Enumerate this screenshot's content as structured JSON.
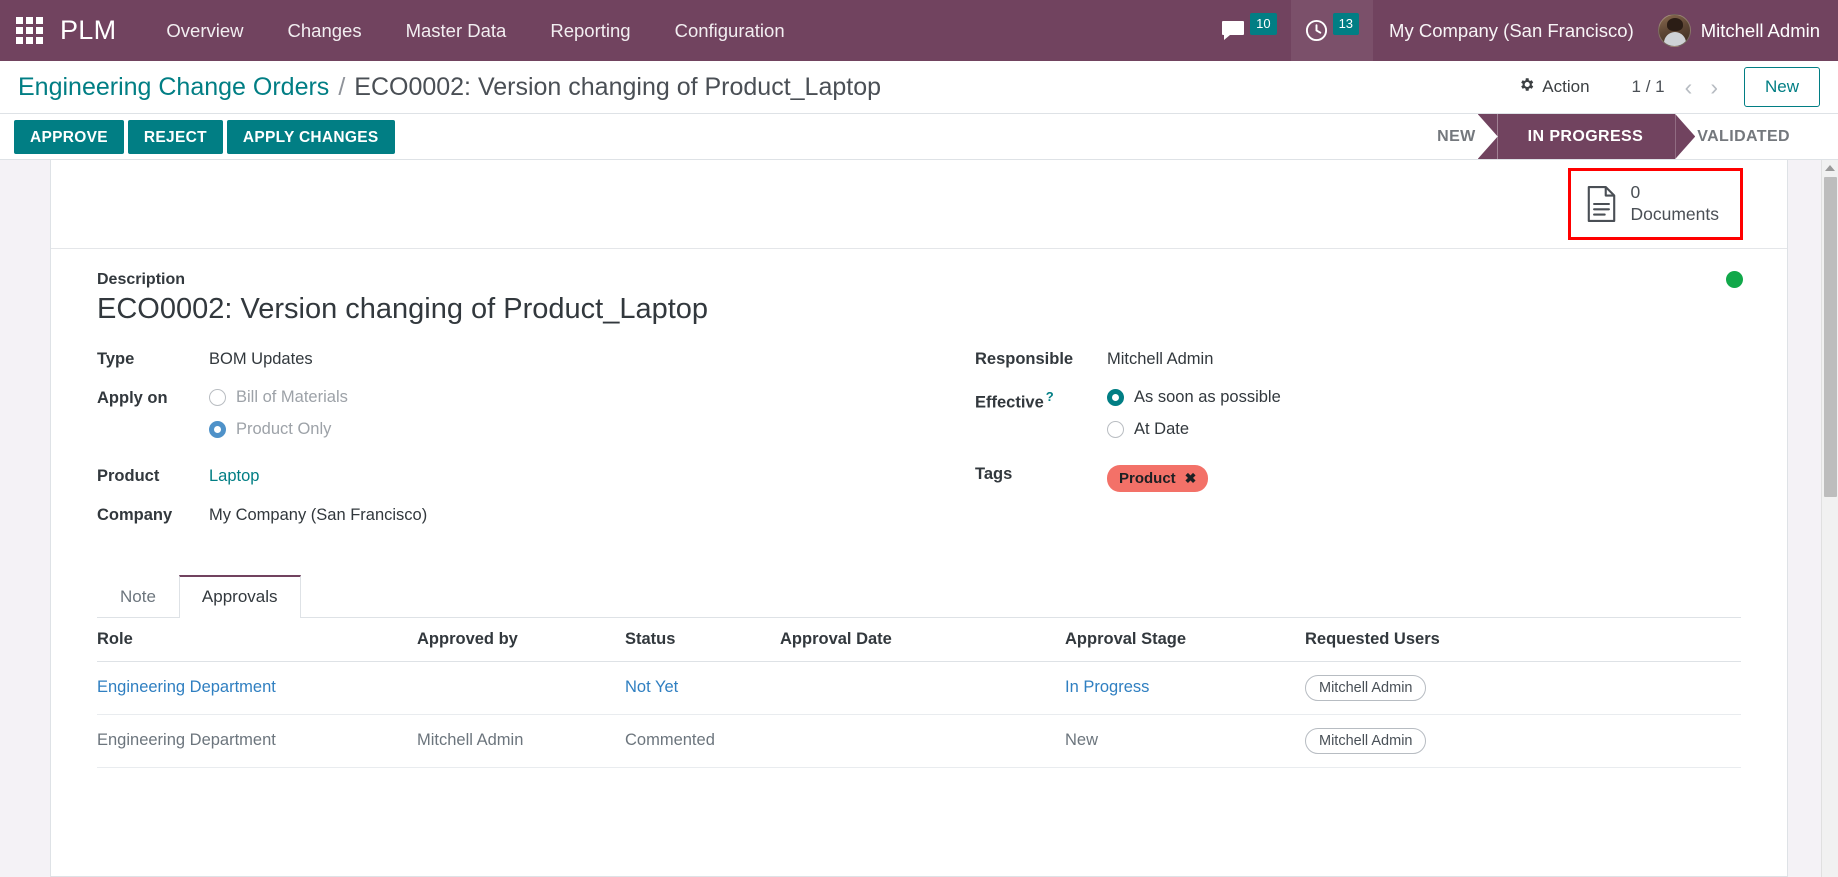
{
  "navbar": {
    "apps_icon": "apps-grid-icon",
    "brand": "PLM",
    "menu": [
      {
        "label": "Overview"
      },
      {
        "label": "Changes"
      },
      {
        "label": "Master Data"
      },
      {
        "label": "Reporting"
      },
      {
        "label": "Configuration"
      }
    ],
    "messages": {
      "icon": "chat-icon",
      "count": "10"
    },
    "activities": {
      "icon": "clock-icon",
      "count": "13"
    },
    "company": "My Company (San Francisco)",
    "user": "Mitchell Admin",
    "avatar_icon": "user-avatar",
    "bg_color": "#71435f"
  },
  "control_panel": {
    "breadcrumb_root": "Engineering Change Orders",
    "breadcrumb_separator": "/",
    "breadcrumb_current": "ECO0002: Version changing of Product_Laptop",
    "action_label": "Action",
    "action_icon": "gear-icon",
    "pager": "1 / 1",
    "prev_icon": "chevron-left-icon",
    "next_icon": "chevron-right-icon",
    "new_label": "New",
    "accent_color": "#017e84"
  },
  "statusbar": {
    "buttons": [
      {
        "label": "APPROVE"
      },
      {
        "label": "REJECT"
      },
      {
        "label": "APPLY CHANGES"
      }
    ],
    "stages": [
      {
        "label": "NEW",
        "active": false
      },
      {
        "label": "IN PROGRESS",
        "active": true
      },
      {
        "label": "VALIDATED",
        "active": false
      }
    ]
  },
  "smart_buttons": [
    {
      "icon": "document-icon",
      "value": "0",
      "label": "Documents",
      "highlighted": true
    }
  ],
  "form": {
    "description_label": "Description",
    "description_value": "ECO0002: Version changing of Product_Laptop",
    "status_dot_color": "#11a84a",
    "left": {
      "type_label": "Type",
      "type_value": "BOM Updates",
      "apply_on_label": "Apply on",
      "apply_on_options": [
        {
          "label": "Bill of Materials",
          "selected": false,
          "disabled": true
        },
        {
          "label": "Product Only",
          "selected": true,
          "disabled": true
        }
      ],
      "product_label": "Product",
      "product_value": "Laptop",
      "company_label": "Company",
      "company_value": "My Company (San Francisco)"
    },
    "right": {
      "responsible_label": "Responsible",
      "responsible_value": "Mitchell Admin",
      "effective_label": "Effective",
      "effective_tooltip": "?",
      "effective_options": [
        {
          "label": "As soon as possible",
          "selected": true
        },
        {
          "label": "At Date",
          "selected": false
        }
      ],
      "tags_label": "Tags",
      "tags": [
        {
          "label": "Product",
          "color": "#f37168",
          "remove_icon": "close-icon"
        }
      ]
    }
  },
  "notebook": {
    "tabs": [
      {
        "label": "Note",
        "active": false
      },
      {
        "label": "Approvals",
        "active": true
      }
    ],
    "table": {
      "headers": [
        "Role",
        "Approved by",
        "Status",
        "Approval Date",
        "Approval Stage",
        "Requested Users"
      ],
      "rows": [
        {
          "role": "Engineering Department",
          "approved_by": "",
          "status": "Not Yet",
          "approval_date": "",
          "approval_stage": "In Progress",
          "requested_users": "Mitchell Admin",
          "is_link": true
        },
        {
          "role": "Engineering Department",
          "approved_by": "Mitchell Admin",
          "status": "Commented",
          "approval_date": "",
          "approval_stage": "New",
          "requested_users": "Mitchell Admin",
          "is_link": false
        }
      ]
    }
  }
}
